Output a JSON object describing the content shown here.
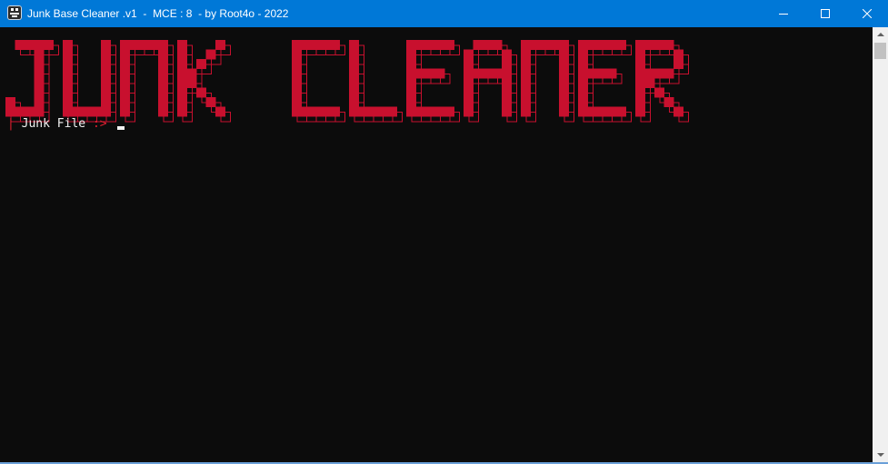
{
  "window": {
    "title": "Junk Base Cleaner .v1  -  MCE : 8  - by Root4o - 2022",
    "icon": "app-icon",
    "controls": {
      "minimize": "minimize-icon",
      "maximize": "maximize-icon",
      "close": "close-icon"
    },
    "accent_color": "#0078d7"
  },
  "console": {
    "banner_text": "JUNK CLEANER",
    "banner_color": "#c8102e",
    "prompt_bar": "|",
    "prompt_label": "Junk File ",
    "prompt_arrow": ":>",
    "input_value": "",
    "background": "#0c0c0c"
  }
}
